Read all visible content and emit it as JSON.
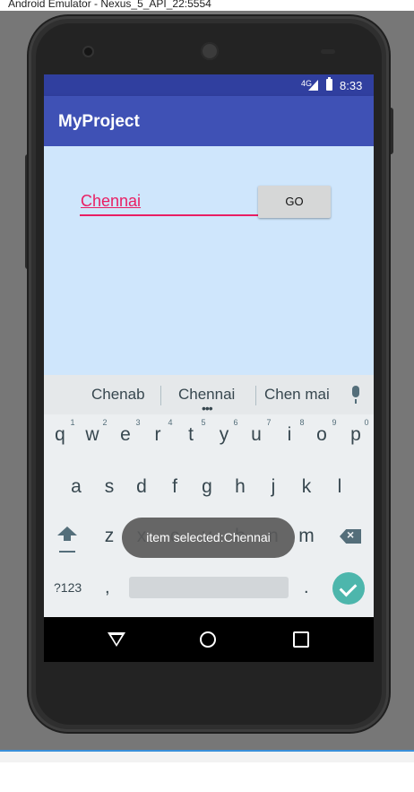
{
  "window": {
    "title": "Android Emulator - Nexus_5_API_22:5554"
  },
  "status_bar": {
    "network": "4G",
    "time": "8:33"
  },
  "app_bar": {
    "title": "MyProject"
  },
  "form": {
    "city_value": "Chennai",
    "go_label": "GO"
  },
  "keyboard": {
    "suggestions": [
      "Chenab",
      "Chennai",
      "Chen mai"
    ],
    "row1": [
      "q",
      "w",
      "e",
      "r",
      "t",
      "y",
      "u",
      "i",
      "o",
      "p"
    ],
    "row1_hints": [
      "1",
      "2",
      "3",
      "4",
      "5",
      "6",
      "7",
      "8",
      "9",
      "0"
    ],
    "row2": [
      "a",
      "s",
      "d",
      "f",
      "g",
      "h",
      "j",
      "k",
      "l"
    ],
    "row3": [
      "z",
      "x",
      "c",
      "v",
      "b",
      "n",
      "m"
    ],
    "symbols_label": "?123",
    "comma": ",",
    "period": "."
  },
  "toast": {
    "text": "item selected:Chennai"
  },
  "colors": {
    "primary": "#3f51b5",
    "primary_dark": "#303f9f",
    "accent": "#e91e63",
    "content_bg": "#cfe6fc",
    "enter": "#4db6ac"
  },
  "icons": [
    "mic-icon",
    "shift-icon",
    "backspace-icon",
    "check-icon",
    "back-icon",
    "home-icon",
    "recents-icon",
    "battery-icon",
    "signal-icon"
  ]
}
